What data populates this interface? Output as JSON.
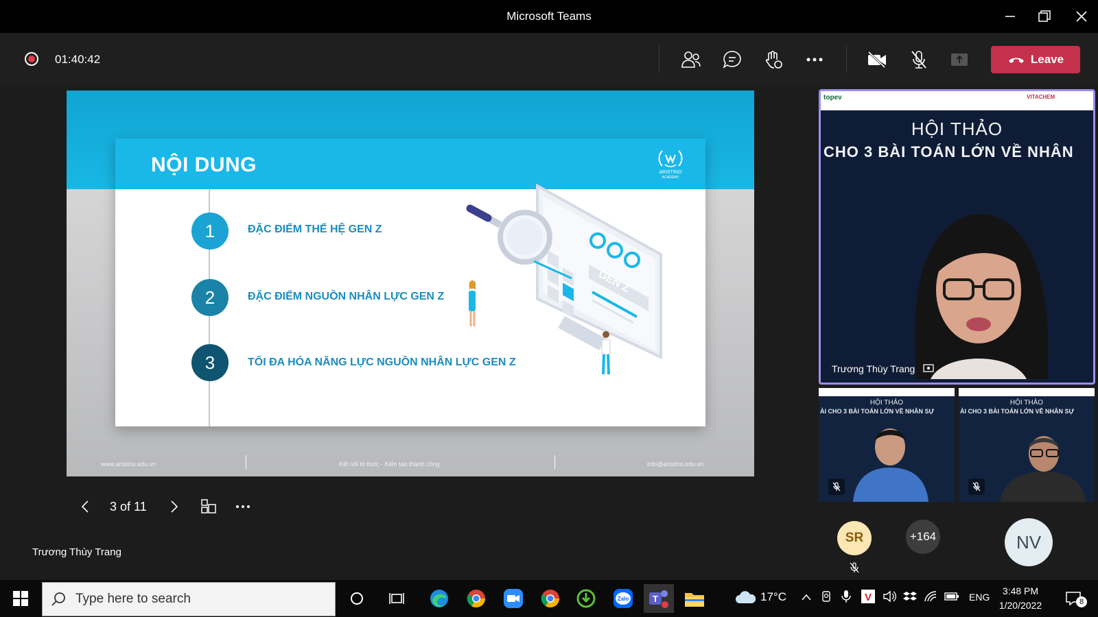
{
  "window": {
    "title": "Microsoft Teams"
  },
  "meeting": {
    "timer": "01:40:42",
    "leave_label": "Leave"
  },
  "slide": {
    "title": "NỘI DUNG",
    "logo_text": "ARISTINO",
    "logo_sub": "ACADEMY",
    "items": [
      {
        "num": "1",
        "text": "ĐẶC ĐIỂM THẾ HỆ GEN Z",
        "color": "#1ba3d3"
      },
      {
        "num": "2",
        "text": "ĐẶC ĐIỂM NGUỒN NHÂN LỰC GEN Z",
        "color": "#1b83a8"
      },
      {
        "num": "3",
        "text": "TỐI ĐA HÓA NĂNG LỰC NGUỒN NHÂN LỰC GEN Z",
        "color": "#0f5470"
      }
    ],
    "illustration_label": "GEN Z",
    "footer": {
      "left": "www.aristino.edu.vn",
      "center": "Kết nối tri thức - Kiến tạo thành công",
      "right": "info@aristino.edu.vn"
    }
  },
  "slide_nav": {
    "page_count": "3 of 11"
  },
  "presenter_name": "Trương Thùy Trang",
  "participants": {
    "main_tile": {
      "name": "Trương Thùy Trang",
      "banner_line1": "HỘI THẢO",
      "banner_line2": "CHO 3 BÀI TOÁN LỚN VỀ NHÂN"
    },
    "small_tiles": [
      {
        "line1": "HỘI THẢO",
        "line2": "ÀI CHO 3 BÀI TOÁN LỚN VỀ NHÂN SỰ"
      },
      {
        "line1": "HỘI THẢO",
        "line2": "ÀI CHO 3 BÀI TOÁN LỚN VỀ NHÂN SỰ"
      }
    ],
    "avatars": {
      "sr": "SR",
      "overflow": "+164",
      "nv": "NV"
    }
  },
  "taskbar": {
    "search_placeholder": "Type here to search",
    "weather": "17°C",
    "lang": "ENG",
    "time": "3:48 PM",
    "date": "1/20/2022",
    "notif_count": "8"
  },
  "colors": {
    "accent_teams": "#9b8ef2",
    "leave": "#c4314b",
    "record": "#e33a4c"
  }
}
